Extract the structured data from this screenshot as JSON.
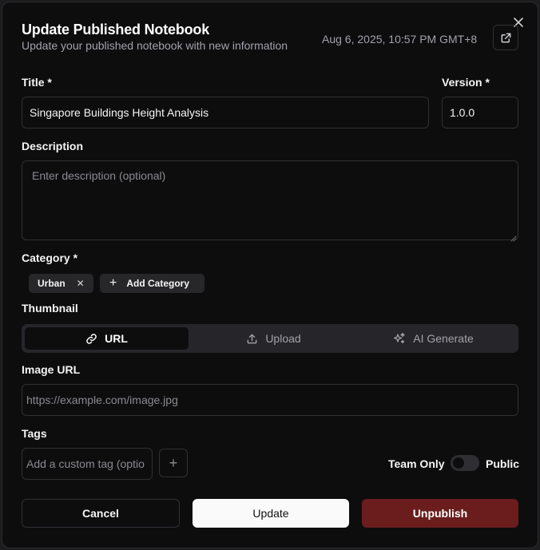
{
  "dialog": {
    "title": "Update Published Notebook",
    "subtitle": "Update your published notebook with new information",
    "timestamp": "Aug 6, 2025, 10:57 PM GMT+8"
  },
  "form": {
    "title_label": "Title *",
    "title_value": "Singapore Buildings Height Analysis",
    "version_label": "Version *",
    "version_value": "1.0.0",
    "description_label": "Description",
    "description_placeholder": "Enter description (optional)",
    "category_label": "Category *",
    "categories": [
      "Urban"
    ],
    "add_category_label": "Add Category",
    "thumbnail_label": "Thumbnail",
    "thumbnail_tabs": [
      {
        "label": "URL",
        "icon": "link-icon",
        "active": true
      },
      {
        "label": "Upload",
        "icon": "upload-icon",
        "active": false
      },
      {
        "label": "AI Generate",
        "icon": "sparkles-icon",
        "active": false
      }
    ],
    "image_url_label": "Image URL",
    "image_url_placeholder": "https://example.com/image.jpg",
    "tags_label": "Tags",
    "tag_placeholder": "Add a custom tag (optional)",
    "visibility": {
      "left": "Team Only",
      "right": "Public",
      "is_public": false
    }
  },
  "actions": {
    "cancel": "Cancel",
    "update": "Update",
    "unpublish": "Unpublish"
  },
  "colors": {
    "background": "#0e0d0e",
    "border": "#2f2f33",
    "primary_button": "#fafafa",
    "danger_button": "#6b1d1d"
  }
}
